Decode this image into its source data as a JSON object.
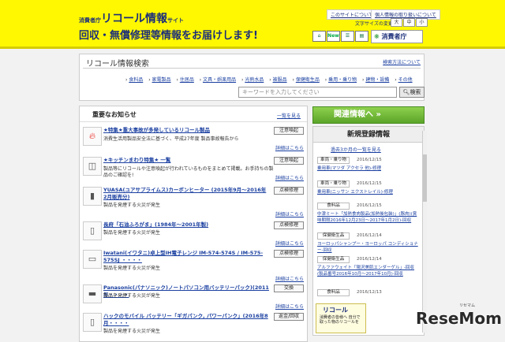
{
  "header": {
    "sub_prefix": "消費者庁",
    "sub_main": "リコール情報",
    "sub_suffix": "サイト",
    "main_title": "回収・無償修理等情報をお届けします!",
    "about_link": "このサイトについて",
    "privacy_link": "個人情報の取り扱いについて",
    "fontsize_label": "文字サイズの変更",
    "fontsize_opts": [
      "大",
      "中",
      "小"
    ],
    "icon_labels": [
      "New"
    ],
    "agency_label": "消費者庁"
  },
  "search": {
    "title": "リコール情報検索",
    "advanced_link": "検索方法について",
    "categories": [
      "食料品",
      "家電製品",
      "住居品",
      "文具・娯楽用品",
      "光熱水品",
      "被服品",
      "保健衛生品",
      "乗用・乗り物",
      "建物・設備",
      "その他"
    ],
    "placeholder": "キーワードを入力してください",
    "button": "検索"
  },
  "news": {
    "title": "重要なお知らせ",
    "list_link": "一覧を見る",
    "items": [
      {
        "title": "★特集★重大事故が多発しているリコール製品",
        "desc": "消費生活用製品安全法に基づく、平成27年度 製品事故報告から",
        "tag": "注意喚起",
        "more": "詳細はこちら"
      },
      {
        "title": "★キッチンまわり特集★ 一覧",
        "desc": "製品等にリコールや注意喚起が行われているものをまとめて掲載。お手持ちの製品のご確認を!",
        "tag": "注意喚起",
        "more": "詳細はこちら"
      },
      {
        "title": "YUASA(ユアサプライムス)カーボンヒーター (2015年9月〜2016年2月販売分)",
        "desc": "製品を発煙する火災が発生",
        "tag": "点検修理",
        "more": "詳細はこちら"
      },
      {
        "title": "長府「石油ふろがま」(1984年〜2001年製)",
        "desc": "製品を発煙する火災が発生",
        "tag": "点検修理",
        "more": "詳細はこちら"
      },
      {
        "title": "Iwatani(イワタニ)卓上型IH電子レンジ IM-574-574S / IM-575-575SJ ・・・・",
        "desc": "製品を発煙する火災が発生",
        "tag": "点検修理",
        "more": "詳細はこちら"
      },
      {
        "title": "Panasonic(パナソニック)ノートパソコン用バッテリーパック)(2011年・・・・",
        "desc": "製品を発煙する火災が発生",
        "tag": "交換",
        "more": "詳細はこちら"
      },
      {
        "title": "ハックのモバイル バッテリー「ギガパンク, パワーパンク」(2016年8月・・・・",
        "desc": "製品を発煙する火災が発生",
        "tag": "返金/回収",
        "more": ""
      }
    ]
  },
  "related": {
    "label": "関連情報へ »"
  },
  "newreg": {
    "title": "新規登録情報",
    "past_link": "過去3か月の一覧を見る",
    "items": [
      {
        "cat": "車両・乗り物",
        "date": "2016/12/15",
        "title": "乗用車(マツダ アクセラ 他)-修理"
      },
      {
        "cat": "車両・乗り物",
        "date": "2016/12/15",
        "title": "乗用車(ニッサン エクストレイル)-修理"
      },
      {
        "cat": "食料品",
        "date": "2016/12/15",
        "title": "中津ミート「加熱食肉製品(加熱後包装)」(豚肉)(賞味期限2016年12月23日〜2017年1月2日)-回収"
      },
      {
        "cat": "保健衛生品",
        "date": "2016/12/14",
        "title": "ヨーロッパシャンプー・ヨーロッパ コンディショナー-回収"
      },
      {
        "cat": "保健衛生品",
        "date": "2016/12/14",
        "title": "アルファウェイト「陽沢美肌エンダーゲル」-回収(製品番号2016年10月〜2017年10月)-回収"
      },
      {
        "cat": "食料品",
        "date": "2016/12/13",
        "title": ""
      }
    ]
  },
  "banner": {
    "title": "リコール",
    "text": "消費者の皆様へ 自分で取った物のリコールを"
  },
  "watermark": {
    "main": "ReseMom",
    "small": "リセマム"
  },
  "colors": {
    "header_bg": "#fff800",
    "accent_green": "#5aa428",
    "title_blue": "#1b2e7a"
  }
}
